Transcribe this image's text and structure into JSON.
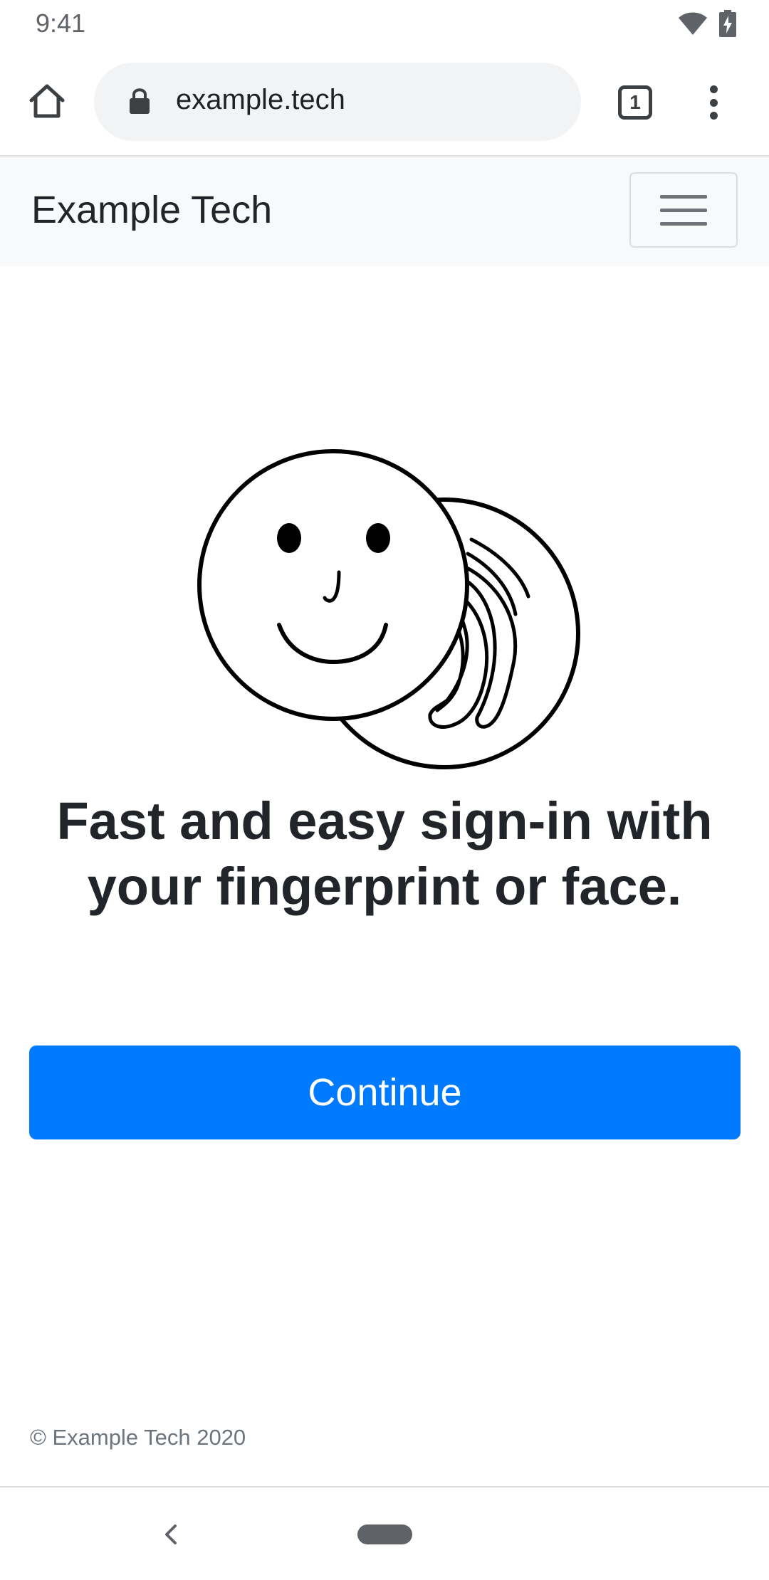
{
  "status_bar": {
    "time": "9:41",
    "icons": [
      "wifi-icon",
      "battery-charging-icon"
    ]
  },
  "browser": {
    "url": "example.tech",
    "tab_count": "1",
    "icons": [
      "home-icon",
      "lock-icon",
      "tab-switcher-icon",
      "more-vert-icon"
    ]
  },
  "navbar": {
    "brand": "Example Tech",
    "toggle_icon": "hamburger-menu-icon"
  },
  "main": {
    "illustration": "face-fingerprint-icon",
    "headline_line1": "Fast and easy sign-in with",
    "headline_line2": "your fingerprint or face.",
    "continue_label": "Continue",
    "accent_color": "#007bff"
  },
  "footer": {
    "copyright": "© Example Tech 2020"
  },
  "system_nav": {
    "icons": [
      "back-chevron-icon",
      "home-pill-icon"
    ]
  }
}
